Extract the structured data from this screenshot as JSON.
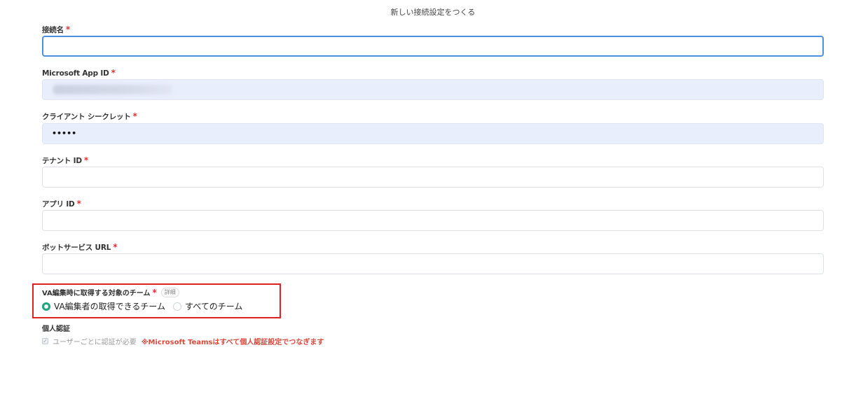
{
  "page": {
    "title": "新しい接続設定をつくる"
  },
  "required_mark": "*",
  "fields": {
    "connection_name": {
      "label": "接続名",
      "value": ""
    },
    "app_id": {
      "label": "Microsoft App ID",
      "value": ""
    },
    "client_secret": {
      "label": "クライアント シークレット",
      "value": "•••••"
    },
    "tenant_id": {
      "label": "テナント ID",
      "value": ""
    },
    "app_id_2": {
      "label": "アプリ ID",
      "value": ""
    },
    "bot_service_url": {
      "label": "ボットサービス URL",
      "value": ""
    }
  },
  "team_scope": {
    "label": "VA編集時に取得する対象のチーム",
    "detail": "詳細",
    "options": [
      {
        "label": "VA編集者の取得できるチーム",
        "selected": true
      },
      {
        "label": "すべてのチーム",
        "selected": false
      }
    ]
  },
  "personal_auth": {
    "label": "個人認証",
    "checkbox_label": "ユーザーごとに認証が必要",
    "checked": true,
    "note": "※Microsoft Teamsはすべて個人認証設定でつなぎます"
  },
  "colors": {
    "accent": "#1ea57e",
    "required": "#d33333",
    "focus": "#4a8fe0",
    "highlight_box": "#e02020",
    "note": "#d9483b"
  }
}
